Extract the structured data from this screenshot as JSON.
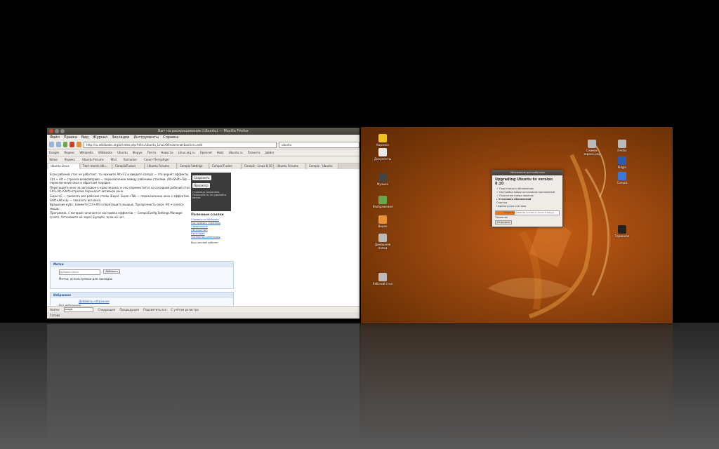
{
  "browser": {
    "window_title": "Быт на раскрашивание (Ubuntu) — Mozilla Firefox",
    "menu": [
      "Файл",
      "Правка",
      "Вид",
      "Журнал",
      "Закладки",
      "Инструменты",
      "Справка"
    ],
    "url": "http://ru.wikibooks.org/w/index.php?title=Ubuntu_Linux/Обновление&action=edit",
    "search_value": "ubuntu",
    "bookmarks_row1": [
      "Google",
      "Яндекс",
      "Wikipedia",
      "Wikibooks",
      "Ubuntu",
      "Форум",
      "Почта",
      "Новости",
      "Linux.org.ru",
      "Opennet",
      "Habr",
      "Ubuntu.ru",
      "Планета",
      "Jabber"
    ],
    "bookmarks_row2": [
      "Yahoo",
      "Яндекс",
      "Ubuntu Forums",
      "Mail",
      "Rutracker",
      "Санкт-Петербург"
    ],
    "tabs": [
      "Ubuntu Linux",
      "Тест после обн...",
      "Compiz/Fusion",
      "Ubuntu Forums",
      "Compiz Settings",
      "Compiz Fusion",
      "Compiz - Linux 8.10",
      "Ubuntu Forums",
      "Compiz - Ubuntu"
    ],
    "article": [
      "Если рабочий стол не работает, то нажмите Alt+F2 и введите compiz — это вернёт эффекты.",
      "Ctrl + Alt + стрелка влево/вправо — переключение между рабочими столами. Alt+Shift+Tab — переключение окон в обратном порядке.",
      "Перетащите окно за заголовок к краю экрана, и оно переместится на соседний рабочий стол. Ctrl+Alt+Shift+стрелка переносит активное окно.",
      "Super+E — показать все рабочие столы (Expo). Super+Tab — переключение окон с эффектом. Shift+Alt+Up — показать все окна.",
      "Вращение куба: зажмите Ctrl+Alt и перетащите мышью. Прозрачность окон: Alt + колесо мыши.",
      "Программа, с которой начинается настройка эффектов — CompizConfig Settings Manager (ccsm). Установите её через Synaptic, если её нет."
    ],
    "editor": {
      "save_label": "Сохранить",
      "preview_label": "Просмотр",
      "note": "Страница сохранена. Пожалуйста, не удаляйте метки."
    },
    "sidebar": {
      "title": "Полезные ссылки",
      "links": [
        "Справка по Wikibooks",
        "Как править страницы",
        "Оформление",
        "Обсуждение",
        "Категории",
        "Последние изменения"
      ],
      "extra": "Ваш личный кабинет"
    },
    "tags_panel": {
      "title": "Метки",
      "placeholder": "Добавить метки",
      "add_label": "Добавить",
      "note": "Метки, используемые для закладок"
    },
    "fav_panel": {
      "title": "Избранное",
      "link": "Добавить избранное",
      "item": "Все избранное"
    },
    "findbar": {
      "label": "Найти:",
      "value": "compiz",
      "next": "Следующее",
      "prev": "Предыдущее",
      "highlight": "Подсветить все",
      "case": "С учётом регистра"
    },
    "status": "Готово"
  },
  "desktop": {
    "icons": [
      "Корзина",
      "Документы",
      "Музыка",
      "Изображения",
      "Видео",
      "Домашняя папка",
      "Рабочий стол",
      "Снимок экрана.png",
      "Firefox",
      "Pidgin",
      "Compiz",
      "Терминал"
    ],
    "updater": {
      "window_title": "Обновление дистрибутива",
      "heading": "Upgrading Ubuntu to version 8.10",
      "steps": [
        "Подготовка к обновлению",
        "Настройка новых источников приложений",
        "Получение новых пакетов",
        "Установка обновлений",
        "Очистка",
        "Перезагрузка системы"
      ],
      "current_step": 3,
      "progress_fraction": 0.3,
      "progress_text": "Установка пакетов (осталось около 5 минут)",
      "terminal_label": "Терминал",
      "cancel_label": "Отменить"
    }
  }
}
